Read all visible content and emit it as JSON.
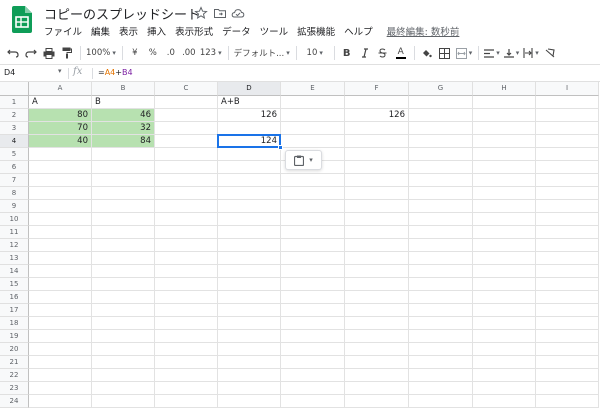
{
  "title": {
    "doc_title": "コピーのスプレッドシート",
    "icons": [
      "star-icon",
      "move-to-folder-icon",
      "cloud-status-icon"
    ]
  },
  "menu": {
    "items": [
      "ファイル",
      "編集",
      "表示",
      "挿入",
      "表示形式",
      "データ",
      "ツール",
      "拡張機能",
      "ヘルプ"
    ],
    "last_edit": "最終編集: 数秒前"
  },
  "toolbar": {
    "zoom": "100%",
    "currency": "¥",
    "percent": "%",
    "decrease_decimal": ".0",
    "increase_decimal": ".00",
    "number_format": "123",
    "font": "デフォルト...",
    "font_size": "10",
    "bold": "B",
    "text_color_glyph": "A",
    "text_color": "#000000"
  },
  "formula_bar": {
    "name_box": "D4",
    "fx": "fx",
    "formula_prefix": "=",
    "formula_ref1": "A4",
    "formula_op": "+",
    "formula_ref2": "B4"
  },
  "grid": {
    "columns": [
      "A",
      "B",
      "C",
      "D",
      "E",
      "F",
      "G",
      "H",
      "I"
    ],
    "selected_column": "D",
    "rows": [
      "1",
      "2",
      "3",
      "4",
      "5",
      "6",
      "7",
      "8",
      "9",
      "10",
      "11",
      "12",
      "13",
      "14",
      "15",
      "16",
      "17",
      "18",
      "19",
      "20",
      "21",
      "22",
      "23",
      "24"
    ],
    "selected_row": "4",
    "cells": {
      "A1": "A",
      "B1": "B",
      "D1": "A+B",
      "A2": "80",
      "B2": "46",
      "D2": "126",
      "F2": "126",
      "A3": "70",
      "B3": "32",
      "A4": "40",
      "B4": "84",
      "D4": "124"
    },
    "highlight_color": "#b7e1b0",
    "selection_color": "#1a73e8"
  }
}
